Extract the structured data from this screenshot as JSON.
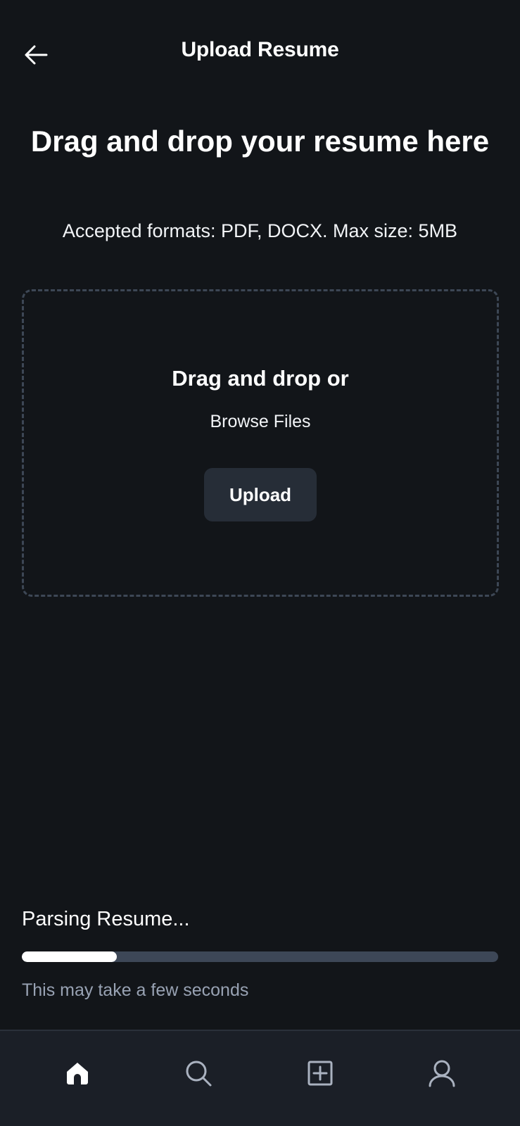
{
  "header": {
    "title": "Upload Resume",
    "back_icon": "arrow-left-icon"
  },
  "intro": {
    "heading": "Drag and drop your resume here",
    "subheading": "Accepted formats: PDF, DOCX. Max size: 5MB"
  },
  "dropzone": {
    "title": "Drag and drop or",
    "browse_label": "Browse Files",
    "upload_label": "Upload"
  },
  "progress": {
    "label": "Parsing Resume...",
    "fraction": 0.2,
    "hint": "This may take a few seconds"
  },
  "bottom_nav": {
    "items": [
      {
        "icon": "home-icon",
        "active": true
      },
      {
        "icon": "search-icon",
        "active": false
      },
      {
        "icon": "add-square-icon",
        "active": false
      },
      {
        "icon": "profile-icon",
        "active": false
      }
    ]
  },
  "colors": {
    "background": "#121519",
    "surface": "#1b1f27",
    "button": "#262d37",
    "progress_track": "#3d4757",
    "progress_fill": "#ffffff",
    "muted_text": "#98a2b3",
    "inactive_icon": "#aab2c0"
  }
}
